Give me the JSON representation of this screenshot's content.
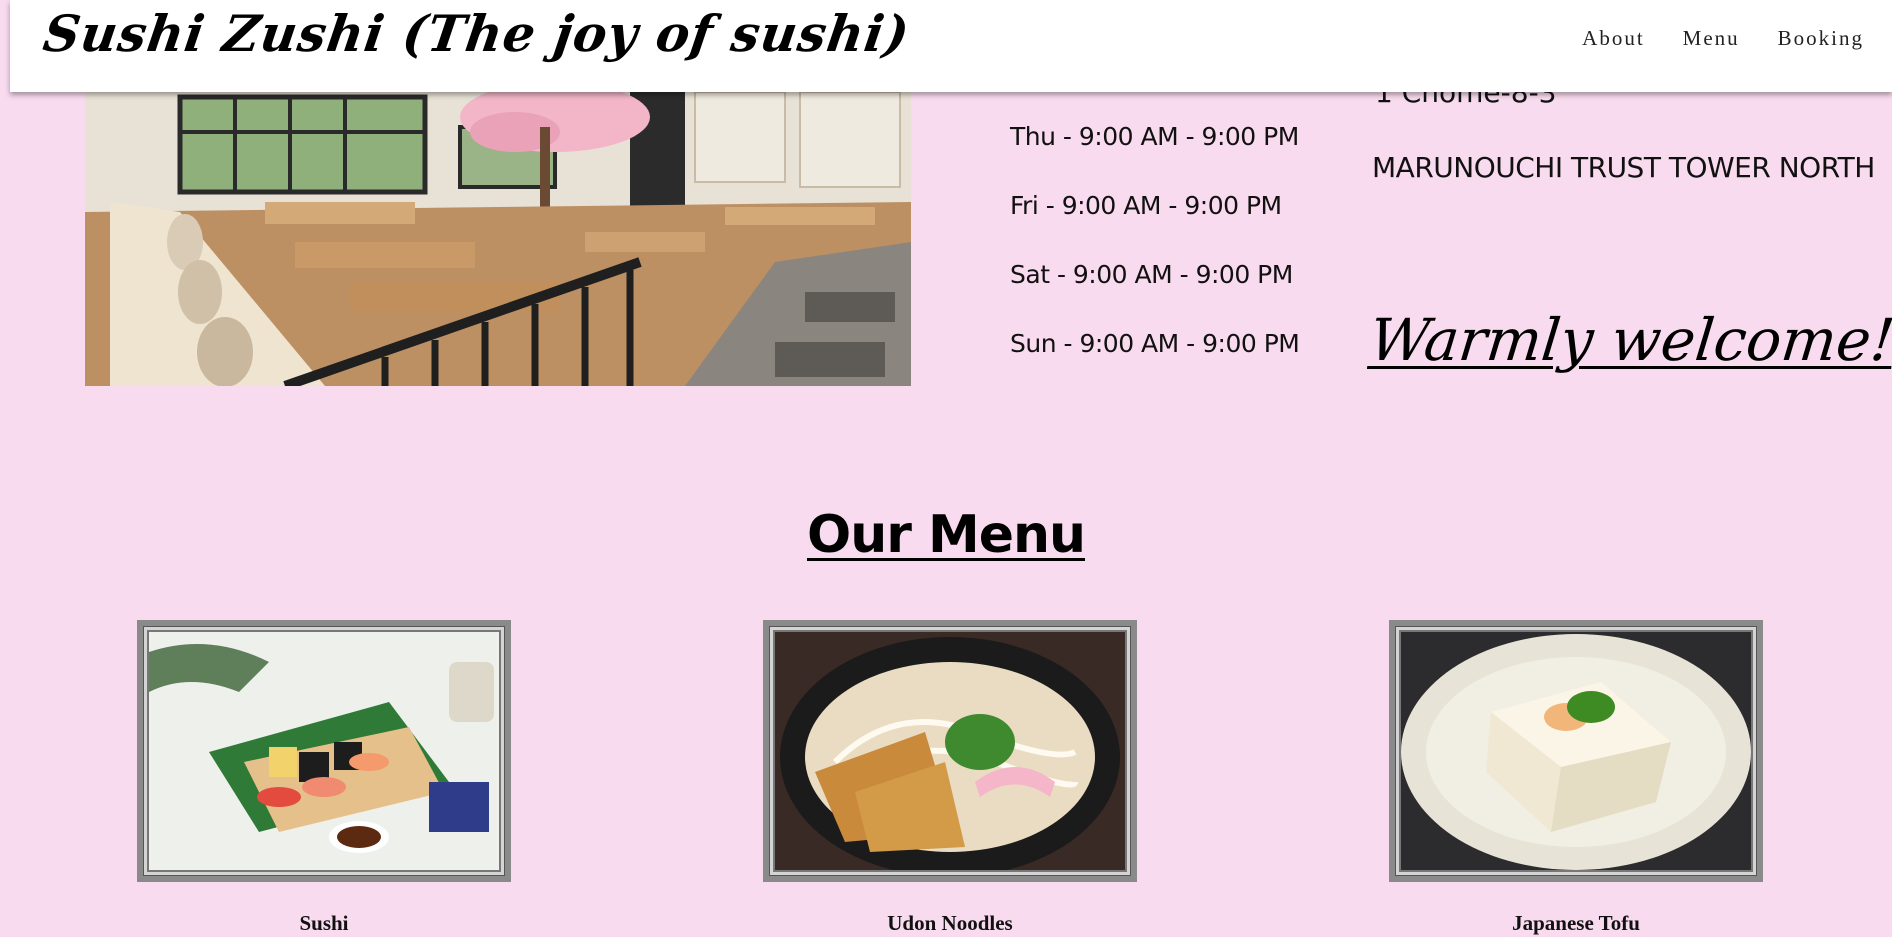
{
  "header": {
    "brand": "Sushi Zushi (The joy of sushi)",
    "nav": [
      {
        "label": "About"
      },
      {
        "label": "Menu"
      },
      {
        "label": "Booking"
      }
    ]
  },
  "hours": [
    "Thu - 9:00 AM - 9:00 PM",
    "Fri - 9:00 AM - 9:00 PM",
    "Sat - 9:00 AM - 9:00 PM",
    "Sun - 9:00 AM - 9:00 PM"
  ],
  "address": {
    "partial_line": "1 Chome-8-3",
    "line": "MARUNOUCHI TRUST TOWER NORTH"
  },
  "welcome": "Warmly welcome!",
  "menu": {
    "title": "Our Menu",
    "items": [
      {
        "label": "Sushi"
      },
      {
        "label": "Udon Noodles"
      },
      {
        "label": "Japanese Tofu"
      }
    ]
  },
  "colors": {
    "page_background": "#f9dbef",
    "header_background": "#ffffff"
  }
}
